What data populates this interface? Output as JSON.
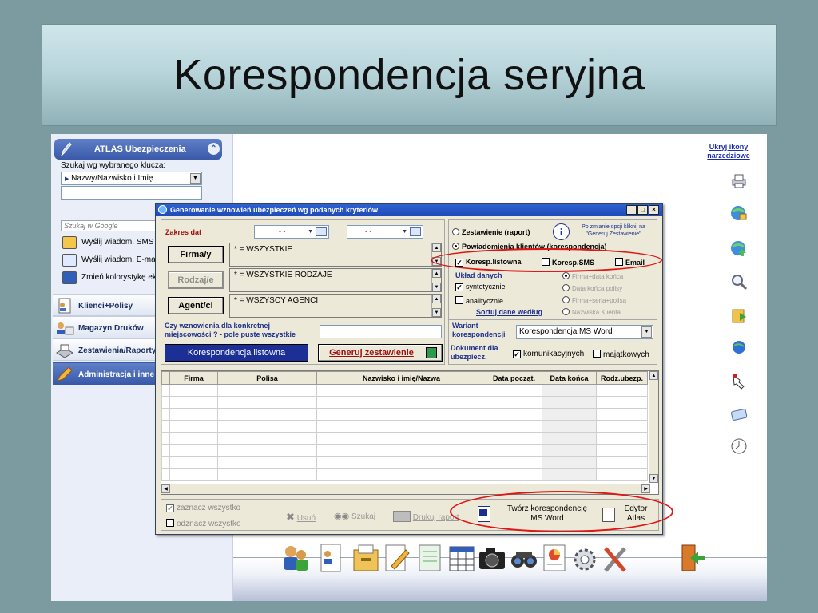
{
  "slide": {
    "title": "Korespondencja seryjna"
  },
  "sidebar": {
    "app_title": "ATLAS Ubezpieczenia",
    "search_label": "Szukaj wg wybranego klucza:",
    "search_key": "Nazwy/Nazwisko i Imię",
    "google_placeholder": "Szukaj w Google",
    "items": [
      {
        "label": "Wyślij wiadom. SMS",
        "icon": "sms-icon"
      },
      {
        "label": "Wyślij wiadom. E-mail",
        "icon": "email-icon"
      },
      {
        "label": "Zmień kolorystykę ekranu",
        "icon": "monitor-icon"
      }
    ],
    "groups": [
      {
        "label": "Klienci+Polisy",
        "icon": "clients-icon"
      },
      {
        "label": "Magazyn Druków",
        "icon": "warehouse-icon"
      },
      {
        "label": "Zestawienia/Raporty",
        "icon": "reports-icon"
      },
      {
        "label": "Administracja i inne",
        "icon": "admin-icon"
      }
    ]
  },
  "right": {
    "hide_icons_link": "Ukryj ikony narzedziowe"
  },
  "dialog": {
    "title": "Generowanie wznowień ubezpieczeń wg podanych kryteriów",
    "date_range_label": "Zakres dat",
    "date_from": "- -",
    "date_to": "- -",
    "buttons": {
      "firma": "Firma/y",
      "rodzaj": "Rodzaj/e",
      "agent": "Agent/ci"
    },
    "lists": {
      "firma": "* = WSZYSTKIE",
      "rodzaj": "* = WSZYSTKIE RODZAJE",
      "agent": "* = WSZYSCY AGENCI"
    },
    "question": "Czy wznowienia dla konkretnej miejscowości ? - pole puste wszystkie",
    "action_left": "Korespondencja listowna",
    "generate": "Generuj zestawienie",
    "options": {
      "report": "Zestawienie (raport)",
      "notice": "Powiadomienia klientów (korespondencja)",
      "info": "Po zmianie opcji kliknij na \"Generuj Zestawienie\"",
      "chk_listowna": "Koresp.listowna",
      "chk_sms": "Koresp.SMS",
      "chk_email": "Email",
      "data_layout": "Układ danych",
      "synthetic": "syntetycznie",
      "analytic": "analitycznie",
      "sort": "Sortuj dane według",
      "sort_opts": [
        "Firma+data końca",
        "Data końca polisy",
        "Firma+seria+polisa",
        "Nazwiska Klienta"
      ],
      "variant_label": "Wariant korespondencji",
      "variant_value": "Korespondencja MS Word",
      "docs_label": "Dokument dla ubezpiecz.",
      "docs_comm": "komunikacyjnych",
      "docs_prop": "majątkowych"
    },
    "grid": {
      "columns": [
        "",
        "Firma",
        "Polisa",
        "Nazwisko i imię/Nazwa",
        "Data począt.",
        "Data końca",
        "Rodz.ubezp."
      ]
    },
    "footer": {
      "check_all": "zaznacz wszystko",
      "uncheck_all": "odznacz wszystko",
      "delete": "Usuń",
      "search": "Szukaj",
      "print": "Drukuj raport",
      "create_word": "Twórz korespondencję MS Word",
      "editor": "Edytor Atlas"
    }
  },
  "colors": {
    "title_bar": "#bcd8de",
    "slide_bg": "#7c9ba1",
    "highlight": "#e01515",
    "dialog_title": "#2351c6"
  }
}
